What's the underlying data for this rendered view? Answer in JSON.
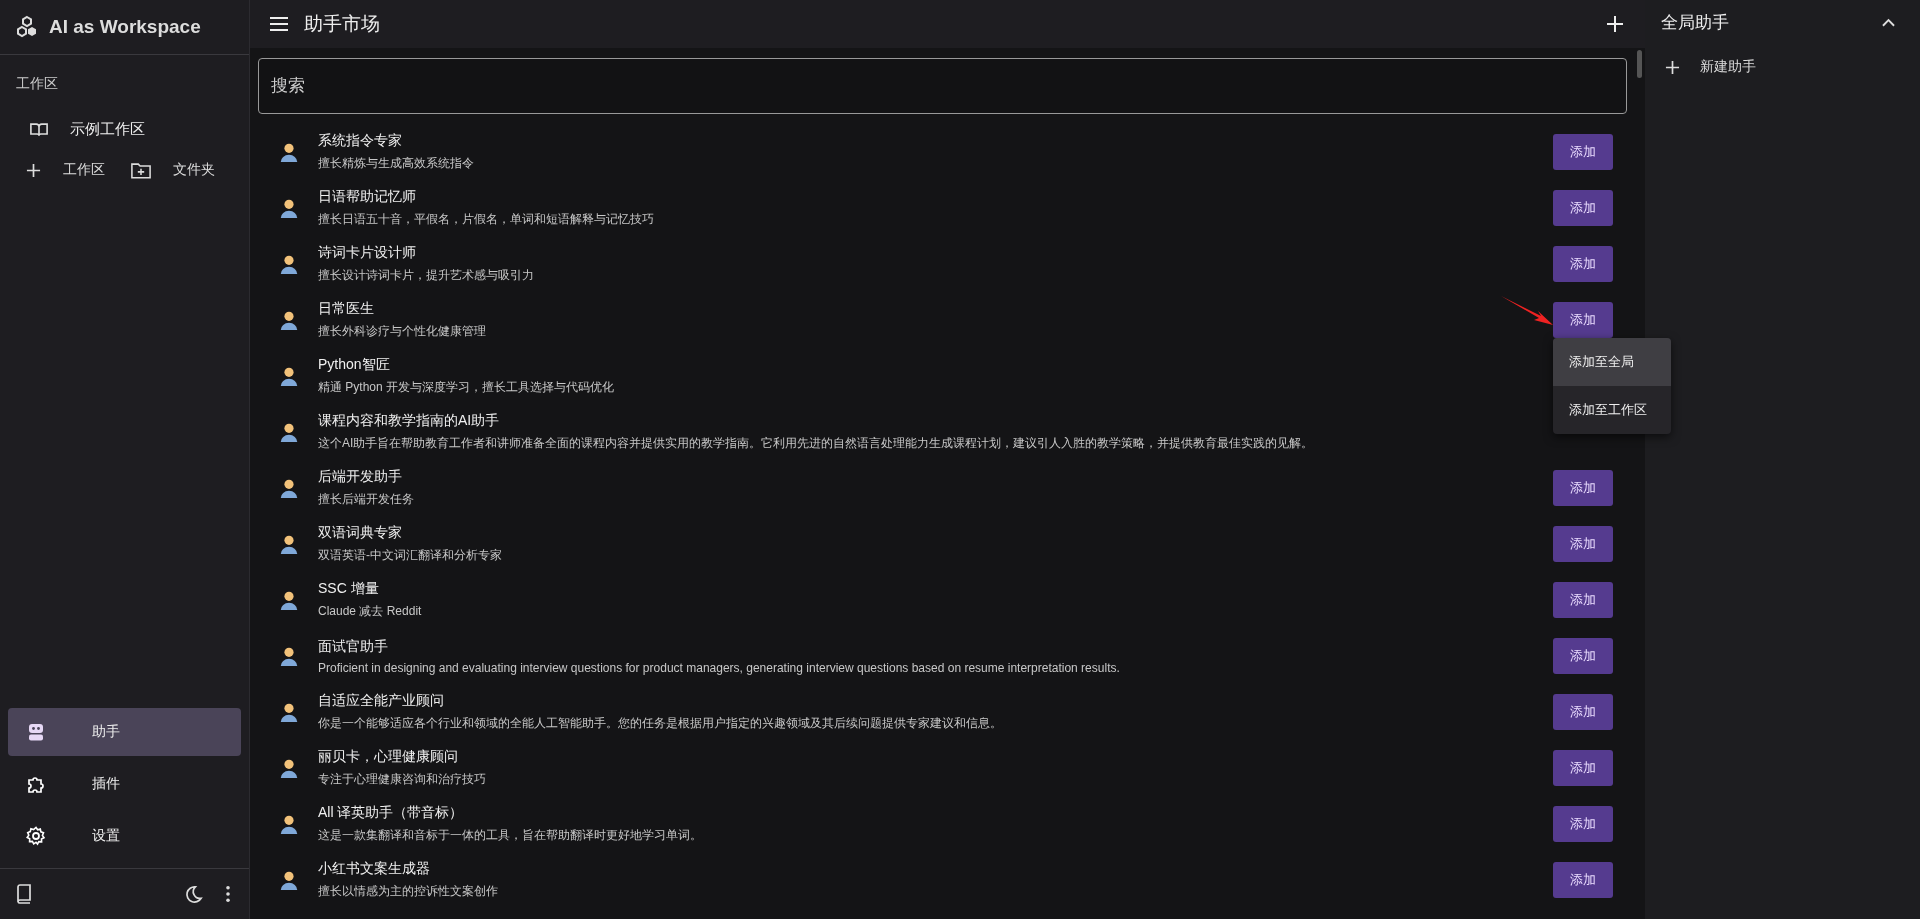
{
  "app": {
    "title": "AI as Workspace"
  },
  "sidebar": {
    "section_label": "工作区",
    "workspaces": [
      {
        "label": "示例工作区"
      }
    ],
    "actions": [
      {
        "kind": "add",
        "label": "工作区"
      },
      {
        "kind": "folder",
        "label": "文件夹"
      }
    ],
    "nav": [
      {
        "kind": "robot",
        "label": "助手",
        "selected": true
      },
      {
        "kind": "puzzle",
        "label": "插件",
        "selected": false
      },
      {
        "kind": "gear",
        "label": "设置",
        "selected": false
      }
    ]
  },
  "header": {
    "title": "助手市场"
  },
  "search": {
    "placeholder": "搜索"
  },
  "assistants": [
    {
      "title": "系统指令专家",
      "description": "擅长精炼与生成高效系统指令",
      "action": "添加"
    },
    {
      "title": "日语帮助记忆师",
      "description": "擅长日语五十音，平假名，片假名，单词和短语解释与记忆技巧",
      "action": "添加"
    },
    {
      "title": "诗词卡片设计师",
      "description": "擅长设计诗词卡片，提升艺术感与吸引力",
      "action": "添加"
    },
    {
      "title": "日常医生",
      "description": "擅长外科诊疗与个性化健康管理",
      "action": "添加"
    },
    {
      "title": "Python智匠",
      "description": "精通 Python 开发与深度学习，擅长工具选择与代码优化"
    },
    {
      "title": "课程内容和教学指南的AI助手",
      "description": "这个AI助手旨在帮助教育工作者和讲师准备全面的课程内容并提供实用的教学指南。它利用先进的自然语言处理能力生成课程计划，建议引人入胜的教学策略，并提供教育最佳实践的见解。"
    },
    {
      "title": "后端开发助手",
      "description": "擅长后端开发任务",
      "action": "添加"
    },
    {
      "title": "双语词典专家",
      "description": "双语英语-中文词汇翻译和分析专家",
      "action": "添加"
    },
    {
      "title": "SSC 增量",
      "description": "Claude 减去 Reddit",
      "action": "添加"
    },
    {
      "title": "面试官助手",
      "description": "Proficient in designing and evaluating interview questions for product managers, generating interview questions based on resume interpretation results.",
      "action": "添加"
    },
    {
      "title": "自适应全能产业顾问",
      "description": "你是一个能够适应各个行业和领域的全能人工智能助手。您的任务是根据用户指定的兴趣领域及其后续问题提供专家建议和信息。",
      "action": "添加"
    },
    {
      "title": "丽贝卡，心理健康顾问",
      "description": "专注于心理健康咨询和治疗技巧",
      "action": "添加"
    },
    {
      "title": "All 译英助手（带音标）",
      "description": "这是一款集翻译和音标于一体的工具，旨在帮助翻译时更好地学习单词。",
      "action": "添加"
    },
    {
      "title": "小红书文案生成器",
      "description": "擅长以情感为主的控诉性文案创作",
      "action": "添加"
    }
  ],
  "add_menu": {
    "items": [
      {
        "label": "添加至全局",
        "selected": true
      },
      {
        "label": "添加至工作区",
        "selected": false
      }
    ]
  },
  "global_panel": {
    "title": "全局助手",
    "expanded": true,
    "new_label": "新建助手"
  }
}
